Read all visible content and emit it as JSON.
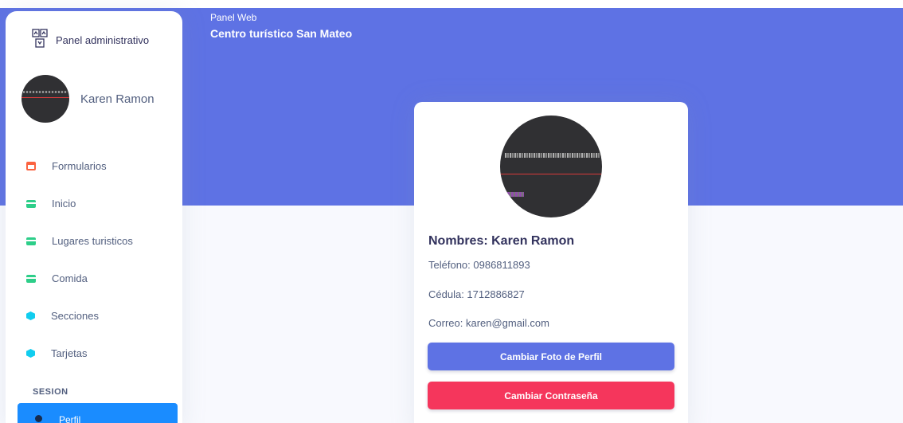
{
  "header": {
    "small": "Panel Web",
    "title": "Centro turístico San Mateo"
  },
  "sidebar": {
    "brand": "Panel administrativo",
    "user_name": "Karen Ramon",
    "items": [
      {
        "label": "Formularios",
        "icon": "calendar-icon"
      },
      {
        "label": "Inicio",
        "icon": "card-icon"
      },
      {
        "label": "Lugares turisticos",
        "icon": "card-icon"
      },
      {
        "label": "Comida",
        "icon": "card-icon"
      },
      {
        "label": "Secciones",
        "icon": "cube-icon"
      },
      {
        "label": "Tarjetas",
        "icon": "cube-icon"
      }
    ],
    "section_label": "SESION",
    "active_item": "Perfil"
  },
  "profile": {
    "name": "Nombres: Karen Ramon",
    "phone": "Teléfono: 0986811893",
    "id_number": "Cédula: 1712886827",
    "email": "Correo: karen@gmail.com",
    "change_photo": "Cambiar Foto de Perfil",
    "change_password": "Cambiar Contraseña"
  },
  "colors": {
    "primary": "#5e72e4",
    "danger": "#f5365c",
    "active": "#1a8cff",
    "success": "#2dce89",
    "info": "#11cdef",
    "warning": "#fb6340"
  }
}
